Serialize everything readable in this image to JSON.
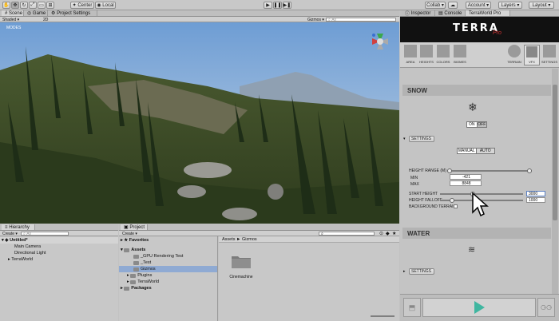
{
  "toolbar": {
    "center_label": "Center",
    "local_label": "Local",
    "collab_label": "Collab",
    "account_label": "Account",
    "layers_label": "Layers",
    "layout_label": "Layout"
  },
  "scene_tabs": {
    "scene": "Scene",
    "game": "Game",
    "project_settings": "Project Settings",
    "shading_mode": "Shaded",
    "two_d": "2D",
    "gizmos": "Gizmos",
    "search_placeholder": "All",
    "modes_label": "MODES"
  },
  "right_tabs": {
    "inspector": "Inspector",
    "console": "Console",
    "terraworld": "TerraWorld Pro"
  },
  "terra_logo": {
    "main": "TERRA",
    "sub": "Pro"
  },
  "terra_nav": {
    "left": [
      "AREA",
      "HEIGHTS",
      "COLORS",
      "BIOMES"
    ],
    "right": [
      "TERRAIN",
      "VFX",
      "SETTINGS"
    ]
  },
  "snow": {
    "title": "SNOW",
    "on": "ON",
    "off": "OFF",
    "settings": "SETTINGS",
    "manual": "MANUAL",
    "auto": "AUTO",
    "height_range_label": "HEIGHT RANGE (M)",
    "min_label": "MIN",
    "min_value": "-421",
    "max_label": "MAX",
    "max_value": "8848",
    "start_height_label": "START HEIGHT",
    "start_height_value": "3000",
    "height_falloff_label": "HEIGHT FALLOFF",
    "height_falloff_value": "1000",
    "background_terrain_label": "BACKGROUND TERRAIN"
  },
  "water": {
    "title": "WATER",
    "settings": "SETTINGS"
  },
  "hierarchy": {
    "tab": "Hierarchy",
    "create": "Create",
    "search_placeholder": "All",
    "scene_name": "Untitled*",
    "items": [
      "Main Camera",
      "Directional Light",
      "TerraWorld"
    ]
  },
  "project": {
    "tab": "Project",
    "create": "Create",
    "favorites": "Favorites",
    "assets": "Assets",
    "folders": [
      "_GPU Rendering Test",
      "_Test",
      "Gizmos",
      "Plugins",
      "TerraWorld"
    ],
    "packages": "Packages",
    "breadcrumb_root": "Assets",
    "breadcrumb_sep": "►",
    "breadcrumb_current": "Gizmos",
    "asset_name": "Cinemachine"
  },
  "colors": {
    "accent": "#8faad3",
    "terra_bg": "#111111",
    "play_green": "#3fb6a0"
  }
}
